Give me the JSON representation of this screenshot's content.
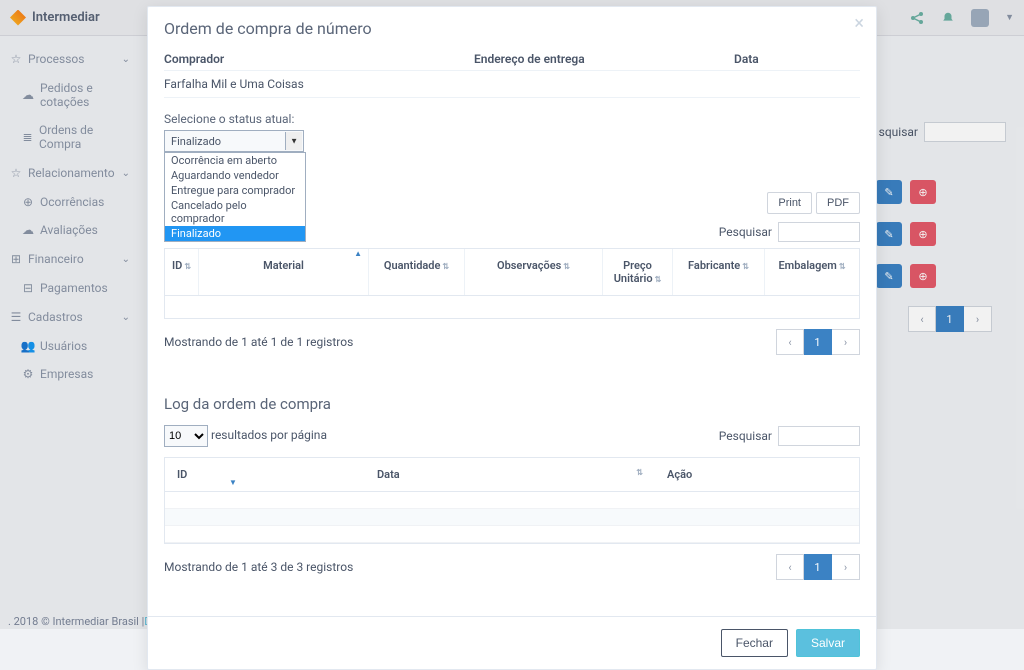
{
  "brand": "Intermediar",
  "sidebar": {
    "sections": [
      {
        "label": "Processos",
        "items": [
          {
            "label": "Pedidos e cotações",
            "icon": "☁"
          },
          {
            "label": "Ordens de Compra",
            "icon": "≣"
          }
        ]
      },
      {
        "label": "Relacionamento",
        "items": [
          {
            "label": "Ocorrências",
            "icon": "⊕"
          },
          {
            "label": "Avaliações",
            "icon": "☁"
          }
        ]
      },
      {
        "label": "Financeiro",
        "items": [
          {
            "label": "Pagamentos",
            "icon": "⊟"
          }
        ]
      },
      {
        "label": "Cadastros",
        "items": [
          {
            "label": "Usuários",
            "icon": "👤"
          },
          {
            "label": "Empresas",
            "icon": "⚙"
          }
        ]
      }
    ]
  },
  "footer": {
    "prefix": ". 2018 © Intermediar Brasil | ",
    "link": "Desen"
  },
  "bg": {
    "search_label": "squisar"
  },
  "modal": {
    "title": "Ordem de compra de número",
    "info_labels": {
      "buyer": "Comprador",
      "address": "Endereço de entrega",
      "date": "Data"
    },
    "buyer_value": "Farfalha Mil e Uma Coisas",
    "status_label": "Selecione o status atual:",
    "status_selected": "Finalizado",
    "status_options": [
      "Ocorrência em aberto",
      "Aguardando vendedor",
      "Entregue para comprador",
      "Cancelado pelo comprador",
      "Finalizado"
    ],
    "buttons": {
      "print": "Print",
      "pdf": "PDF",
      "close": "Fechar",
      "save": "Salvar"
    },
    "search_label": "Pesquisar",
    "table1": {
      "cols": [
        "ID",
        "Material",
        "Quantidade",
        "Observações",
        "Preço Unitário",
        "Fabricante",
        "Embalagem"
      ],
      "info": "Mostrando de 1 até 1 de 1 registros"
    },
    "log": {
      "title": "Log da ordem de compra",
      "page_size": "10",
      "page_size_suffix": "resultados por página",
      "cols": [
        "ID",
        "Data",
        "Ação"
      ],
      "info": "Mostrando de 1 até 3 de 3 registros"
    },
    "page_active": "1"
  }
}
